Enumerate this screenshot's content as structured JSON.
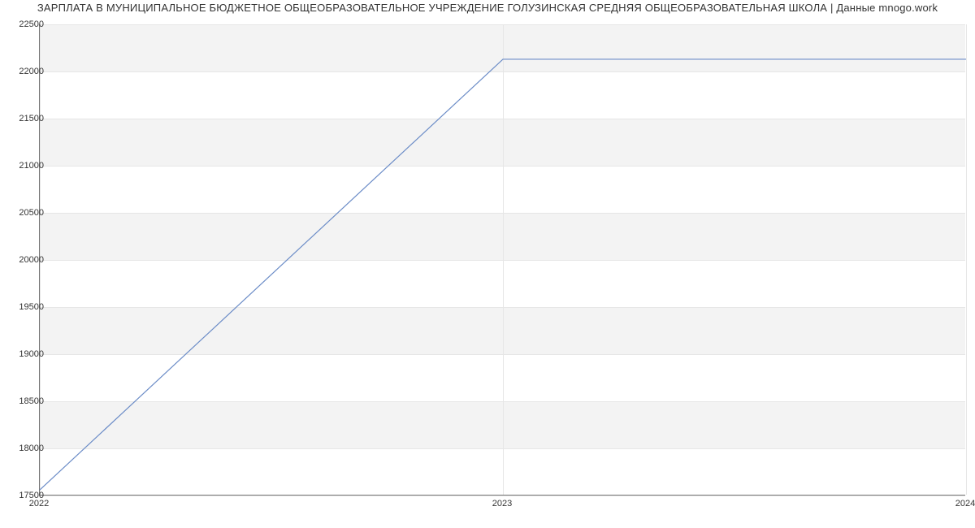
{
  "chart_data": {
    "type": "line",
    "title": "ЗАРПЛАТА В МУНИЦИПАЛЬНОЕ БЮДЖЕТНОЕ ОБЩЕОБРАЗОВАТЕЛЬНОЕ УЧРЕЖДЕНИЕ ГОЛУЗИНСКАЯ СРЕДНЯЯ ОБЩЕОБРАЗОВАТЕЛЬНАЯ ШКОЛА | Данные mnogo.work",
    "x": [
      2022,
      2023,
      2024
    ],
    "y": [
      17560,
      22130,
      22130
    ],
    "xlabel": "",
    "ylabel": "",
    "xlim": [
      2022,
      2024
    ],
    "ylim": [
      17500,
      22500
    ],
    "x_ticks": [
      2022,
      2023,
      2024
    ],
    "y_ticks": [
      17500,
      18000,
      18500,
      19000,
      19500,
      20000,
      20500,
      21000,
      21500,
      22000,
      22500
    ],
    "grid": true,
    "line_color": "#6b8cc7"
  }
}
